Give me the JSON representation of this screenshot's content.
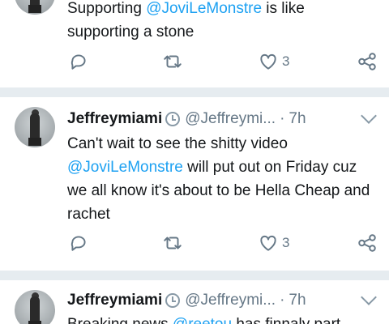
{
  "tweets": [
    {
      "text_parts": [
        "Supporting ",
        "@JoviLeMonstre",
        " is like supporting a stone"
      ],
      "reply_count": "",
      "retweet_count": "",
      "like_count": "3"
    },
    {
      "name": "Jeffreymiami",
      "handle": "@Jeffreymi...",
      "dot": "·",
      "time": "7h",
      "text_parts": [
        "Can't wait to see the shitty video ",
        "@JoviLeMonstre",
        " will put out on Friday cuz we all know it's about to be Hella Cheap and rachet"
      ],
      "reply_count": "",
      "retweet_count": "",
      "like_count": "3"
    },
    {
      "name": "Jeffreymiami",
      "handle": "@Jeffreymi...",
      "dot": "·",
      "time": "7h",
      "text_parts": [
        "Breaking news ",
        "@reetou",
        " has finnaly part"
      ]
    }
  ],
  "colors": {
    "accent": "#1da1f2",
    "muted": "#657786",
    "separator": "#e6ecf0"
  },
  "icons": [
    "reply-icon",
    "retweet-icon",
    "like-icon",
    "share-icon",
    "clock-icon",
    "chevron-down-icon"
  ]
}
